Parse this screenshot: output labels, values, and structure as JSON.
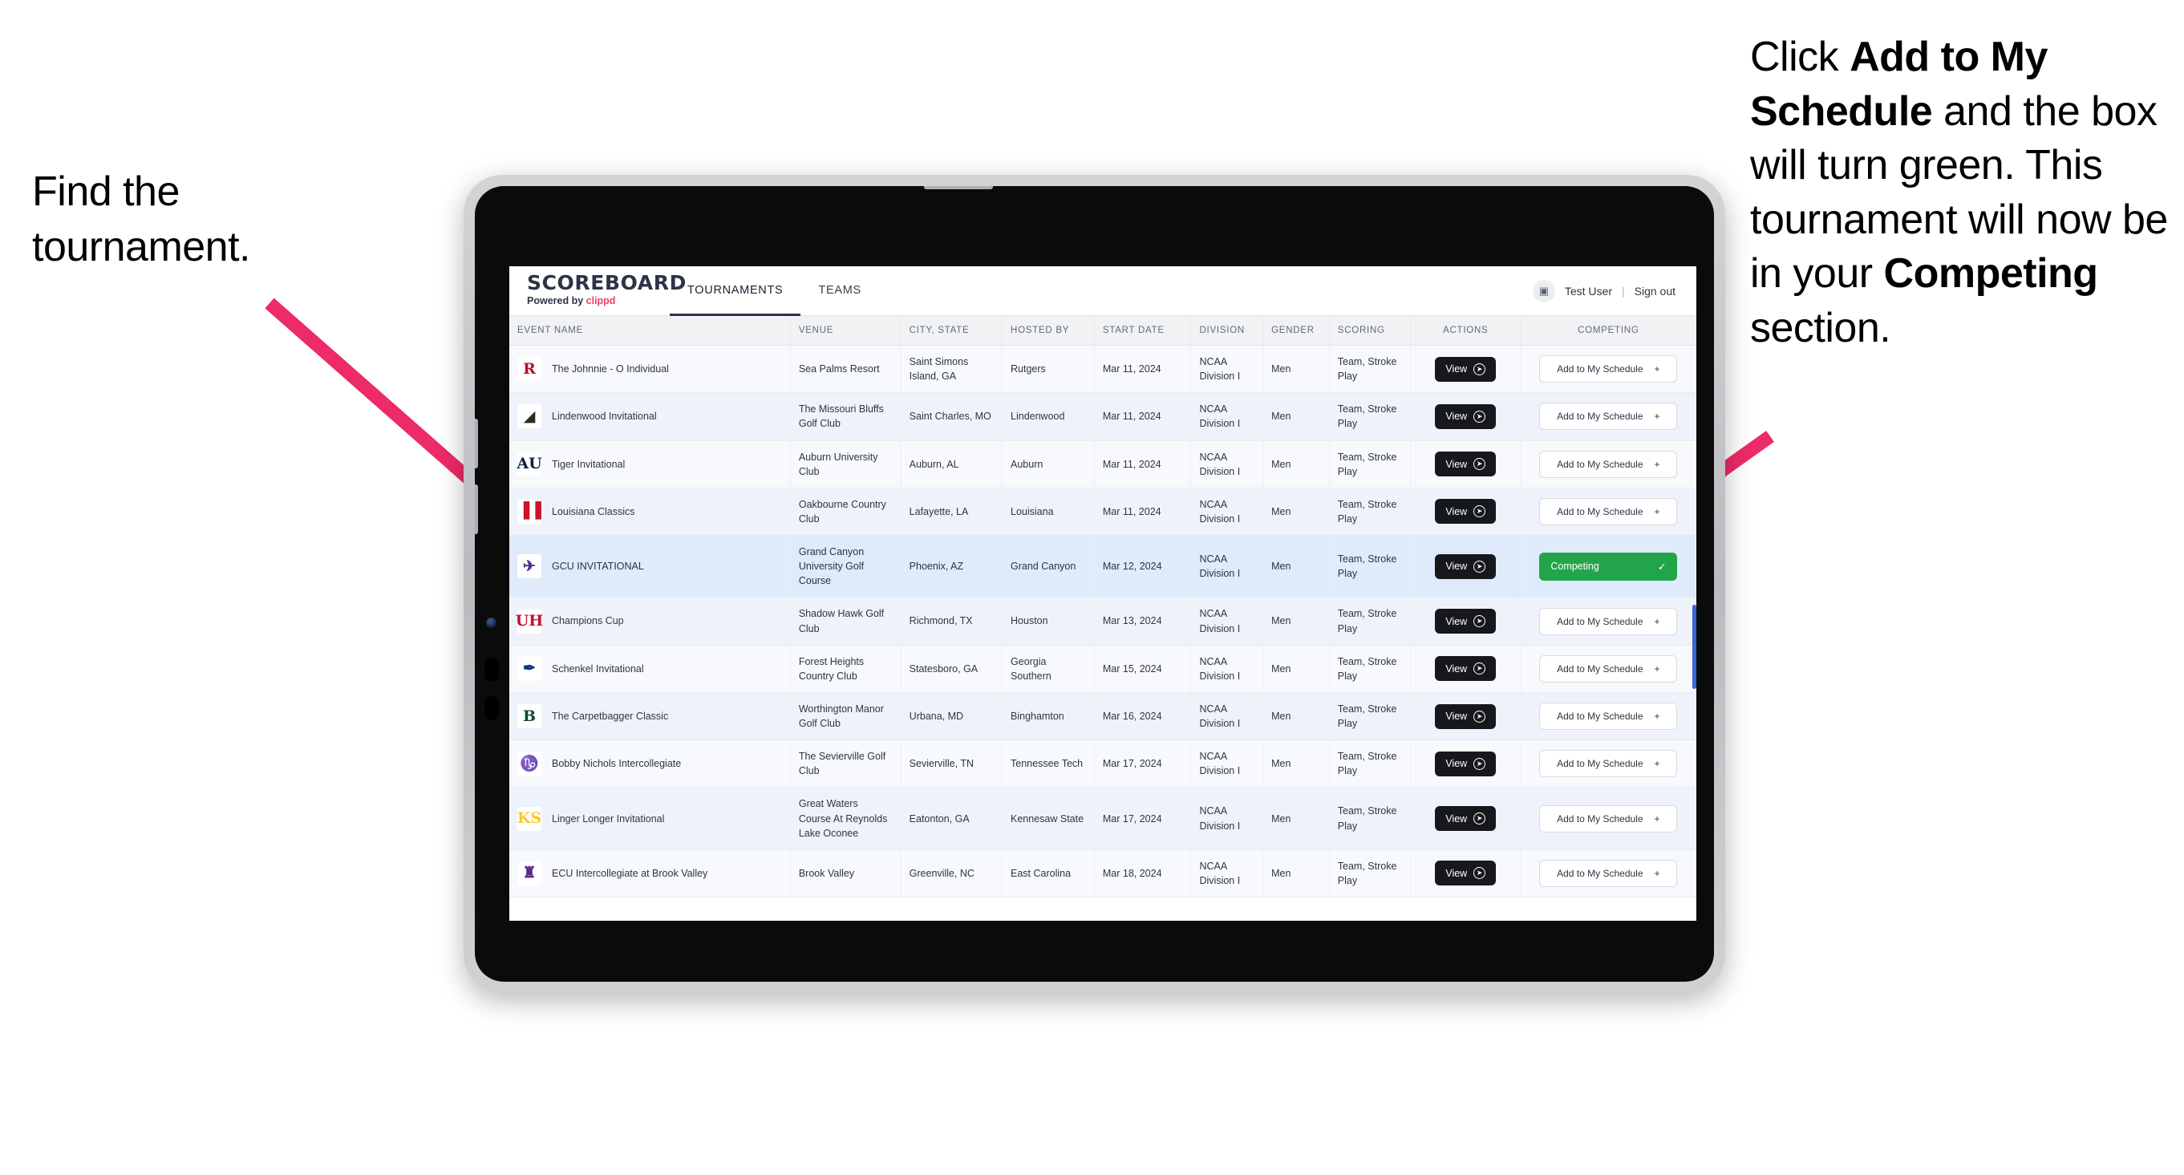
{
  "annotations": {
    "left": "Find the tournament.",
    "right_parts": [
      {
        "t": "Click ",
        "b": false
      },
      {
        "t": "Add to My Schedule",
        "b": true
      },
      {
        "t": " and the box will turn green. This tournament will now be in your ",
        "b": false
      },
      {
        "t": "Competing",
        "b": true
      },
      {
        "t": " section.",
        "b": false
      }
    ],
    "arrow_color": "#ED2B67"
  },
  "app": {
    "brand": {
      "title": "SCOREBOARD",
      "powered_prefix": "Powered by ",
      "powered_brand": "clippd"
    },
    "nav": [
      {
        "label": "TOURNAMENTS",
        "active": true
      },
      {
        "label": "TEAMS",
        "active": false
      }
    ],
    "user": {
      "avatar_icon": "user-card-icon",
      "name": "Test User",
      "separator": "|",
      "signout": "Sign out"
    },
    "columns": [
      "EVENT NAME",
      "VENUE",
      "CITY, STATE",
      "HOSTED BY",
      "START DATE",
      "DIVISION",
      "GENDER",
      "SCORING",
      "ACTIONS",
      "COMPETING"
    ],
    "buttons": {
      "view": "View",
      "view_icon": "arrow-right-circle-icon",
      "add": "Add to My Schedule",
      "add_icon": "plus-icon",
      "competing": "Competing",
      "competing_icon": "check-icon"
    },
    "colors": {
      "competing_green": "#22A54A",
      "view_dark": "#17181C",
      "accent_pink": "#EF3E63",
      "selected_row": "#DFEAFB"
    },
    "rows": [
      {
        "logo": "R",
        "logo_bg": "#ffffff",
        "logo_color": "#B3132B",
        "event": "The Johnnie - O Individual",
        "venue": "Sea Palms Resort",
        "city": "Saint Simons Island, GA",
        "host": "Rutgers",
        "date": "Mar 11, 2024",
        "division": "NCAA Division I",
        "gender": "Men",
        "scoring": "Team, Stroke Play",
        "competing": false
      },
      {
        "logo": "◢",
        "logo_bg": "#ffffff",
        "logo_color": "#2d2a1e",
        "event": "Lindenwood Invitational",
        "venue": "The Missouri Bluffs Golf Club",
        "city": "Saint Charles, MO",
        "host": "Lindenwood",
        "date": "Mar 11, 2024",
        "division": "NCAA Division I",
        "gender": "Men",
        "scoring": "Team, Stroke Play",
        "competing": false
      },
      {
        "logo": "AU",
        "logo_bg": "#ffffff",
        "logo_color": "#0C2340",
        "event": "Tiger Invitational",
        "venue": "Auburn University Club",
        "city": "Auburn, AL",
        "host": "Auburn",
        "date": "Mar 11, 2024",
        "division": "NCAA Division I",
        "gender": "Men",
        "scoring": "Team, Stroke Play",
        "competing": false
      },
      {
        "logo": "▐▐",
        "logo_bg": "#ffffff",
        "logo_color": "#CE1126",
        "event": "Louisiana Classics",
        "venue": "Oakbourne Country Club",
        "city": "Lafayette, LA",
        "host": "Louisiana",
        "date": "Mar 11, 2024",
        "division": "NCAA Division I",
        "gender": "Men",
        "scoring": "Team, Stroke Play",
        "competing": false
      },
      {
        "logo": "✈",
        "logo_bg": "#ffffff",
        "logo_color": "#522398",
        "event": "GCU INVITATIONAL",
        "venue": "Grand Canyon University Golf Course",
        "city": "Phoenix, AZ",
        "host": "Grand Canyon",
        "date": "Mar 12, 2024",
        "division": "NCAA Division I",
        "gender": "Men",
        "scoring": "Team, Stroke Play",
        "competing": true,
        "selected": true
      },
      {
        "logo": "UH",
        "logo_bg": "#ffffff",
        "logo_color": "#C8102E",
        "event": "Champions Cup",
        "venue": "Shadow Hawk Golf Club",
        "city": "Richmond, TX",
        "host": "Houston",
        "date": "Mar 13, 2024",
        "division": "NCAA Division I",
        "gender": "Men",
        "scoring": "Team, Stroke Play",
        "competing": false
      },
      {
        "logo": "✒",
        "logo_bg": "#ffffff",
        "logo_color": "#003087",
        "event": "Schenkel Invitational",
        "venue": "Forest Heights Country Club",
        "city": "Statesboro, GA",
        "host": "Georgia Southern",
        "date": "Mar 15, 2024",
        "division": "NCAA Division I",
        "gender": "Men",
        "scoring": "Team, Stroke Play",
        "competing": false
      },
      {
        "logo": "B",
        "logo_bg": "#ffffff",
        "logo_color": "#0C4936",
        "event": "The Carpetbagger Classic",
        "venue": "Worthington Manor Golf Club",
        "city": "Urbana, MD",
        "host": "Binghamton",
        "date": "Mar 16, 2024",
        "division": "NCAA Division I",
        "gender": "Men",
        "scoring": "Team, Stroke Play",
        "competing": false
      },
      {
        "logo": "♑",
        "logo_bg": "#ffffff",
        "logo_color": "#8B3A9E",
        "event": "Bobby Nichols Intercollegiate",
        "venue": "The Sevierville Golf Club",
        "city": "Sevierville, TN",
        "host": "Tennessee Tech",
        "date": "Mar 17, 2024",
        "division": "NCAA Division I",
        "gender": "Men",
        "scoring": "Team, Stroke Play",
        "competing": false
      },
      {
        "logo": "KS",
        "logo_bg": "#ffffff",
        "logo_color": "#FFC629",
        "event": "Linger Longer Invitational",
        "venue": "Great Waters Course At Reynolds Lake Oconee",
        "city": "Eatonton, GA",
        "host": "Kennesaw State",
        "date": "Mar 17, 2024",
        "division": "NCAA Division I",
        "gender": "Men",
        "scoring": "Team, Stroke Play",
        "competing": false
      },
      {
        "logo": "♜",
        "logo_bg": "#ffffff",
        "logo_color": "#592A8A",
        "event": "ECU Intercollegiate at Brook Valley",
        "venue": "Brook Valley",
        "city": "Greenville, NC",
        "host": "East Carolina",
        "date": "Mar 18, 2024",
        "division": "NCAA Division I",
        "gender": "Men",
        "scoring": "Team, Stroke Play",
        "competing": false,
        "partial": true
      }
    ]
  }
}
